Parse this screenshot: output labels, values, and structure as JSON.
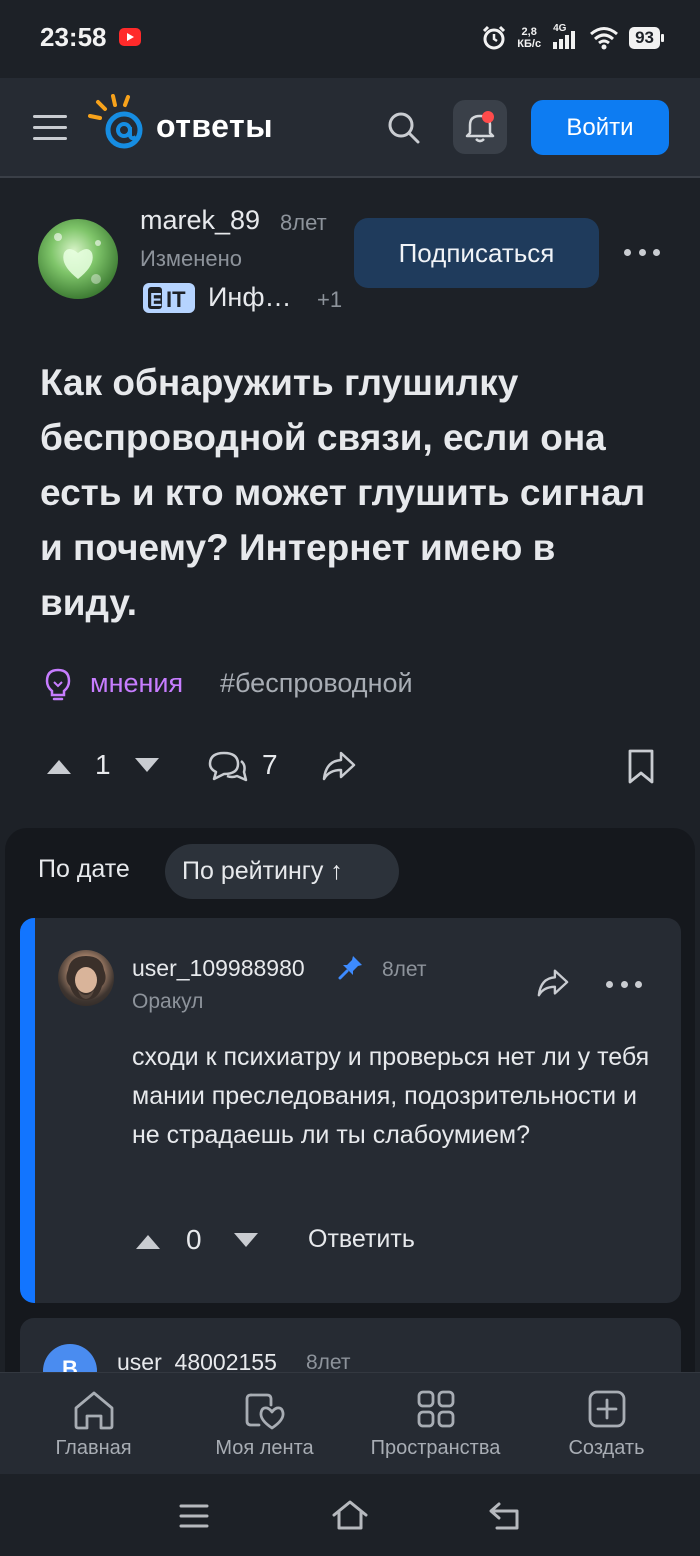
{
  "status_bar": {
    "time": "23:58",
    "net_speed_value": "2,8",
    "net_speed_unit": "КБ/с",
    "network_type": "4G",
    "battery": "93"
  },
  "header": {
    "logo_text": "ответы",
    "login_label": "Войти"
  },
  "question": {
    "author": "marek_89",
    "age": "8лет",
    "edited": "Изменено",
    "category": "Инф…",
    "category_extra": "+1",
    "subscribe_label": "Подписаться",
    "title": "Как обнаружить глушилку беспроводной связи, если она есть и кто может глушить сигнал и почему? Интернет имею в виду.",
    "tag_opinion": "мнения",
    "tag_hash": "#беспроводной",
    "votes": "1",
    "comments": "7"
  },
  "sort": {
    "by_date": "По дате",
    "by_rating": "По рейтингу ↑"
  },
  "answers": [
    {
      "user": "user_109988980",
      "age": "8лет",
      "role": "Оракул",
      "text": "сходи к психиатру и проверься нет ли у тебя мании преследования, подозрительности и не страдаешь ли ты слабоумием?",
      "votes": "0",
      "reply_label": "Ответить"
    },
    {
      "user": "user_48002155",
      "age": "8лет",
      "avatar_letter": "B"
    }
  ],
  "bottom_nav": {
    "items": [
      {
        "label": "Главная",
        "icon": "home-icon"
      },
      {
        "label": "Моя лента",
        "icon": "heart-feed-icon"
      },
      {
        "label": "Пространства",
        "icon": "grid-icon"
      },
      {
        "label": "Создать",
        "icon": "plus-square-icon"
      }
    ]
  },
  "colors": {
    "accent": "#0d7cf2",
    "background": "#1d2127",
    "card": "#262b33",
    "opinion_tag": "#c77dff"
  }
}
